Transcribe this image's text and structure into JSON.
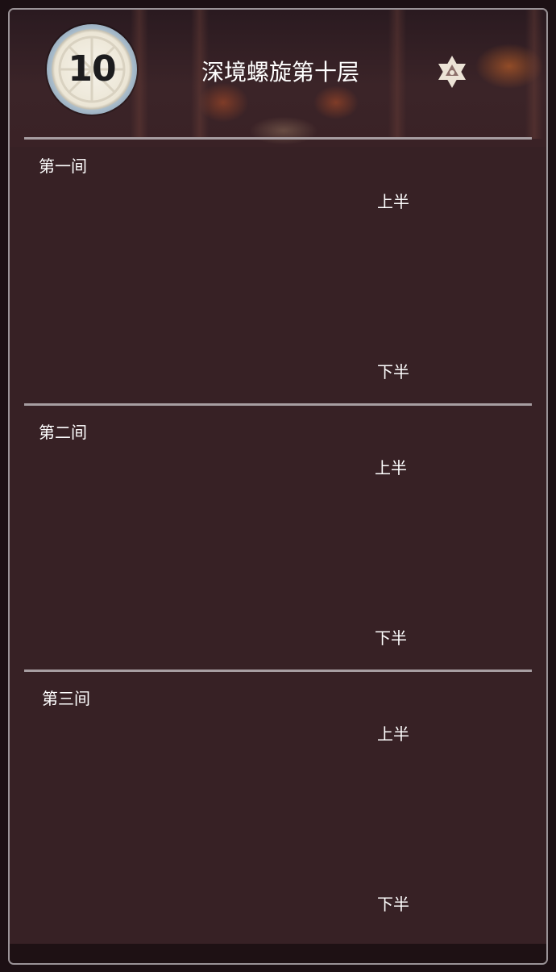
{
  "header": {
    "floor_number": "10",
    "title": "深境螺旋第十层",
    "star_icon": "abyss-star-icon"
  },
  "chambers": [
    {
      "label": "第一间",
      "first_half": "上半",
      "second_half": "下半"
    },
    {
      "label": "第二间",
      "first_half": "上半",
      "second_half": "下半"
    },
    {
      "label": "第三间",
      "first_half": "上半",
      "second_half": "下半"
    }
  ],
  "colors": {
    "panel": "#372125",
    "border": "#9a9397",
    "divider": "#a79ea2",
    "text": "#ffffff"
  }
}
